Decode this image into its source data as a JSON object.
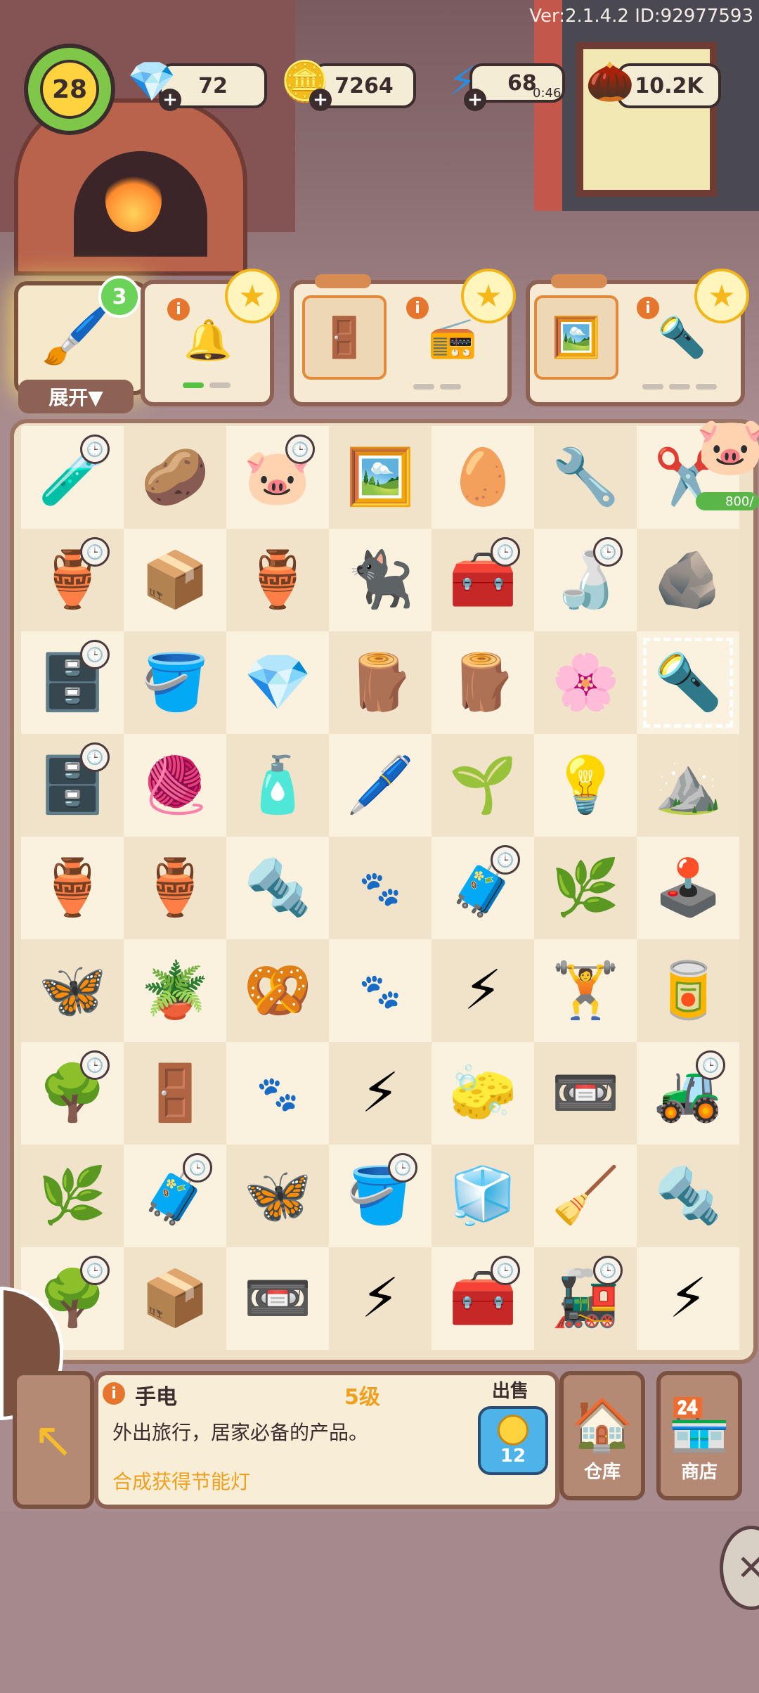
{
  "version": "Ver:2.1.4.2 ID:92977593",
  "player": {
    "level": "28"
  },
  "resources": {
    "gems": "72",
    "coins": "7264",
    "energy": "68",
    "energy_timer": "0:46",
    "seeds": "10.2K"
  },
  "toolbox": {
    "badge": "3",
    "expand_label": "展开▼"
  },
  "orders": [
    {
      "items": [
        "bell-item"
      ],
      "star": true
    },
    {
      "items": [
        "sign-item",
        "radio-item"
      ],
      "star": true
    },
    {
      "items": [
        "photo-item",
        "lamp-item"
      ],
      "star": true
    }
  ],
  "piggy": {
    "progress": "800/"
  },
  "board": {
    "rows": [
      [
        "🧪",
        "🥔",
        "🐷",
        "🖼️",
        "🥚",
        "🔧",
        "✂️"
      ],
      [
        "🏺",
        "📦",
        "🏺",
        "🐈‍⬛",
        "🧰",
        "🍶",
        "🪨"
      ],
      [
        "🗄️",
        "🪣",
        "💎",
        "🪵",
        "🪵",
        "🌸",
        "🔦"
      ],
      [
        "🗄️",
        "🧶",
        "🧴",
        "🖊️",
        "🌱",
        "💡",
        "⛰️"
      ],
      [
        "🏺",
        "🏺",
        "🔩",
        "🐾",
        "🧳",
        "🌿",
        "🕹️"
      ],
      [
        "🦋",
        "🪴",
        "🥨",
        "🐾",
        "⚡",
        "🏋️",
        "🥫"
      ],
      [
        "🌳",
        "🚪",
        "🐾",
        "⚡",
        "🧽",
        "📼",
        "🚜"
      ],
      [
        "🌿",
        "🧳",
        "🦋",
        "🪣",
        "🧊",
        "🧹",
        "🔩"
      ],
      [
        "🌳",
        "📦",
        "📼",
        "⚡",
        "🧰",
        "🚂",
        "⚡"
      ]
    ]
  },
  "selected_item": {
    "name": "手电",
    "level": "5级",
    "sell_label": "出售",
    "sell_price": "12",
    "description": "外出旅行，居家必备的产品。",
    "hint": "合成获得节能灯"
  },
  "buttons": {
    "warehouse": "仓库",
    "shop": "商店"
  }
}
